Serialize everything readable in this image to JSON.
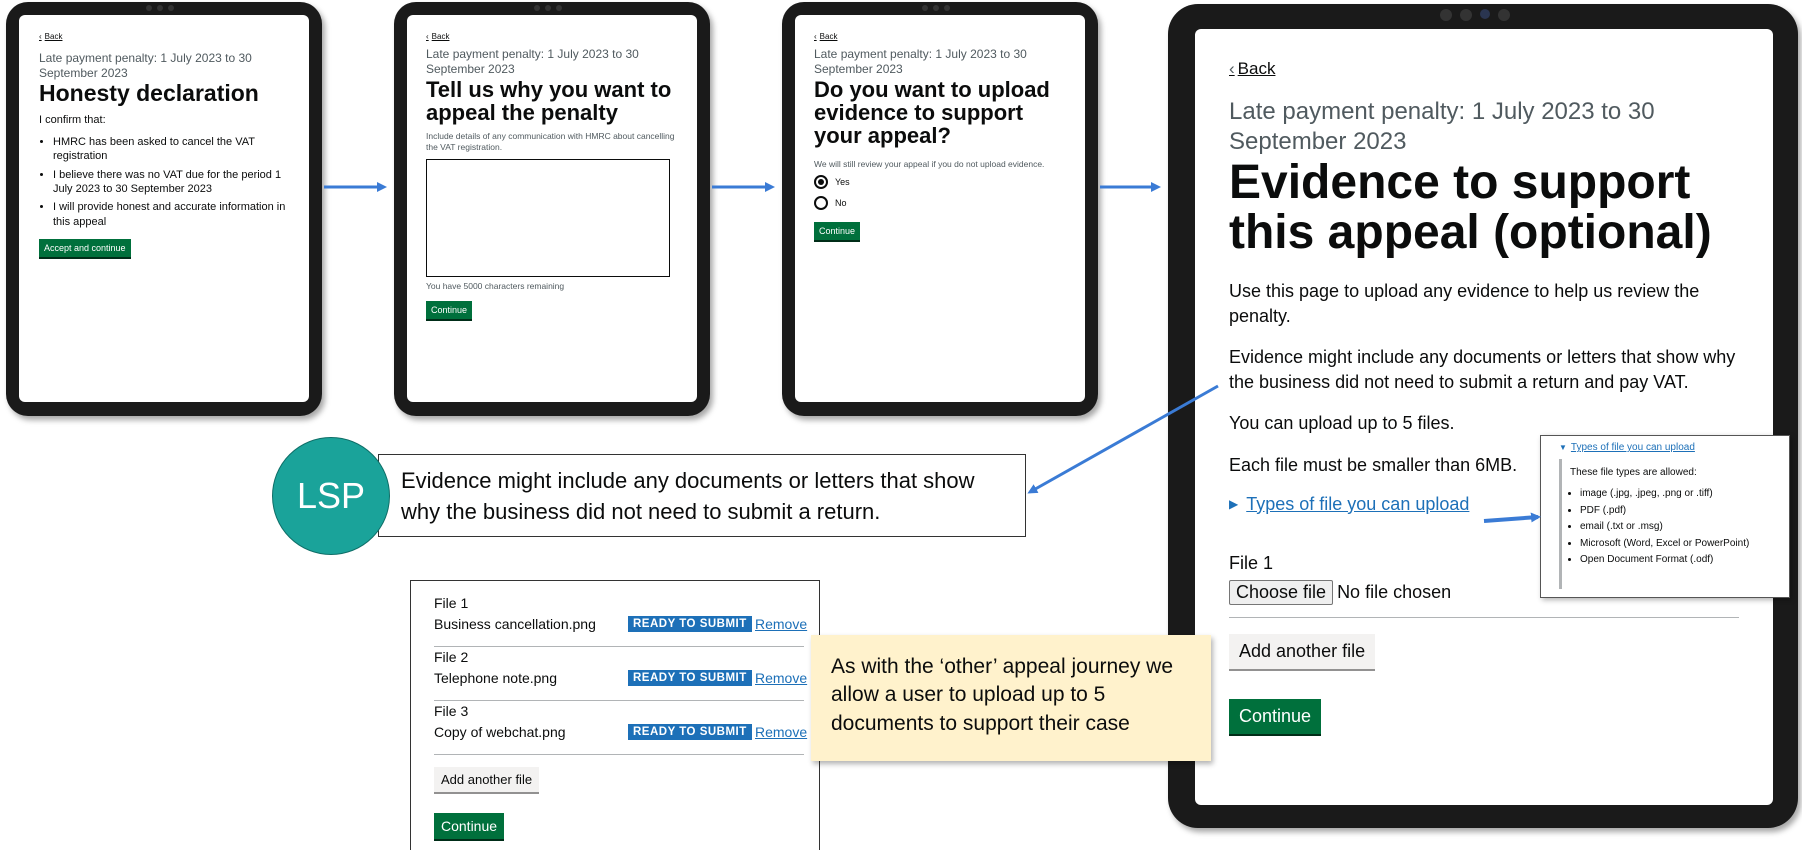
{
  "screen1": {
    "back": "Back",
    "caption": "Late payment penalty: 1 July 2023 to 30 September 2023",
    "title": "Honesty declaration",
    "intro": "I confirm that:",
    "bullets": [
      "HMRC has been asked to cancel the VAT registration",
      "I believe there was no VAT due for the period 1 July 2023 to 30 September 2023",
      "I will provide honest and accurate information in this appeal"
    ],
    "button": "Accept and continue"
  },
  "screen2": {
    "back": "Back",
    "caption": "Late payment penalty: 1 July 2023 to 30 September 2023",
    "title": "Tell us why you want to appeal the penalty",
    "hint": "Include details of any communication with HMRC about cancelling the VAT registration.",
    "textarea_value": "",
    "counter": "You have 5000 characters remaining",
    "button": "Continue"
  },
  "screen3": {
    "back": "Back",
    "caption": "Late payment penalty: 1 July 2023 to 30 September 2023",
    "title": "Do you want to upload evidence to support your appeal?",
    "hint": "We will still review your appeal if you do not upload evidence.",
    "options": [
      "Yes",
      "No"
    ],
    "selected": "Yes",
    "button": "Continue"
  },
  "screen4": {
    "back": "Back",
    "caption": "Late payment penalty: 1 July 2023 to 30 September 2023",
    "title": "Evidence to support this appeal (optional)",
    "p1": "Use this page to upload any evidence to help us review the penalty.",
    "p2": "Evidence might include any documents or letters that show why the business did not need to submit a return and pay VAT.",
    "p3": "You can upload up to 5 files.",
    "p4": "Each file must be smaller than 6MB.",
    "details_summary": "Types of file you can upload",
    "file_label": "File 1",
    "choose_file": "Choose file",
    "no_file": "No file chosen",
    "add_another": "Add another file",
    "button": "Continue"
  },
  "details_popup": {
    "summary": "Types of file you can upload",
    "intro": "These file types are allowed:",
    "items": [
      "image (.jpg, .jpeg, .png or .tiff)",
      "PDF (.pdf)",
      "email (.txt or .msg)",
      "Microsoft (Word, Excel or PowerPoint)",
      "Open Document Format (.odf)"
    ]
  },
  "lsp_note": {
    "badge": "LSP",
    "text": "Evidence might include any documents or letters that show why the business did not need to submit a return."
  },
  "files_panel": {
    "files": [
      {
        "label": "File 1",
        "name": "Business cancellation.png",
        "status": "READY TO SUBMIT",
        "action": "Remove"
      },
      {
        "label": "File 2",
        "name": "Telephone note.png",
        "status": "READY TO SUBMIT",
        "action": "Remove"
      },
      {
        "label": "File 3",
        "name": "Copy of webchat.png",
        "status": "READY TO SUBMIT",
        "action": "Remove"
      }
    ],
    "add_another": "Add another file",
    "button": "Continue"
  },
  "sticky_note": {
    "text": "As with the ‘other’ appeal journey we allow a user to upload up to 5 documents to support their case"
  },
  "colors": {
    "arrow": "#3a7bd5",
    "govuk_green": "#00703c",
    "govuk_blue": "#1d70b8",
    "lsp_teal": "#1aa39a",
    "sticky": "#fff2cc"
  }
}
